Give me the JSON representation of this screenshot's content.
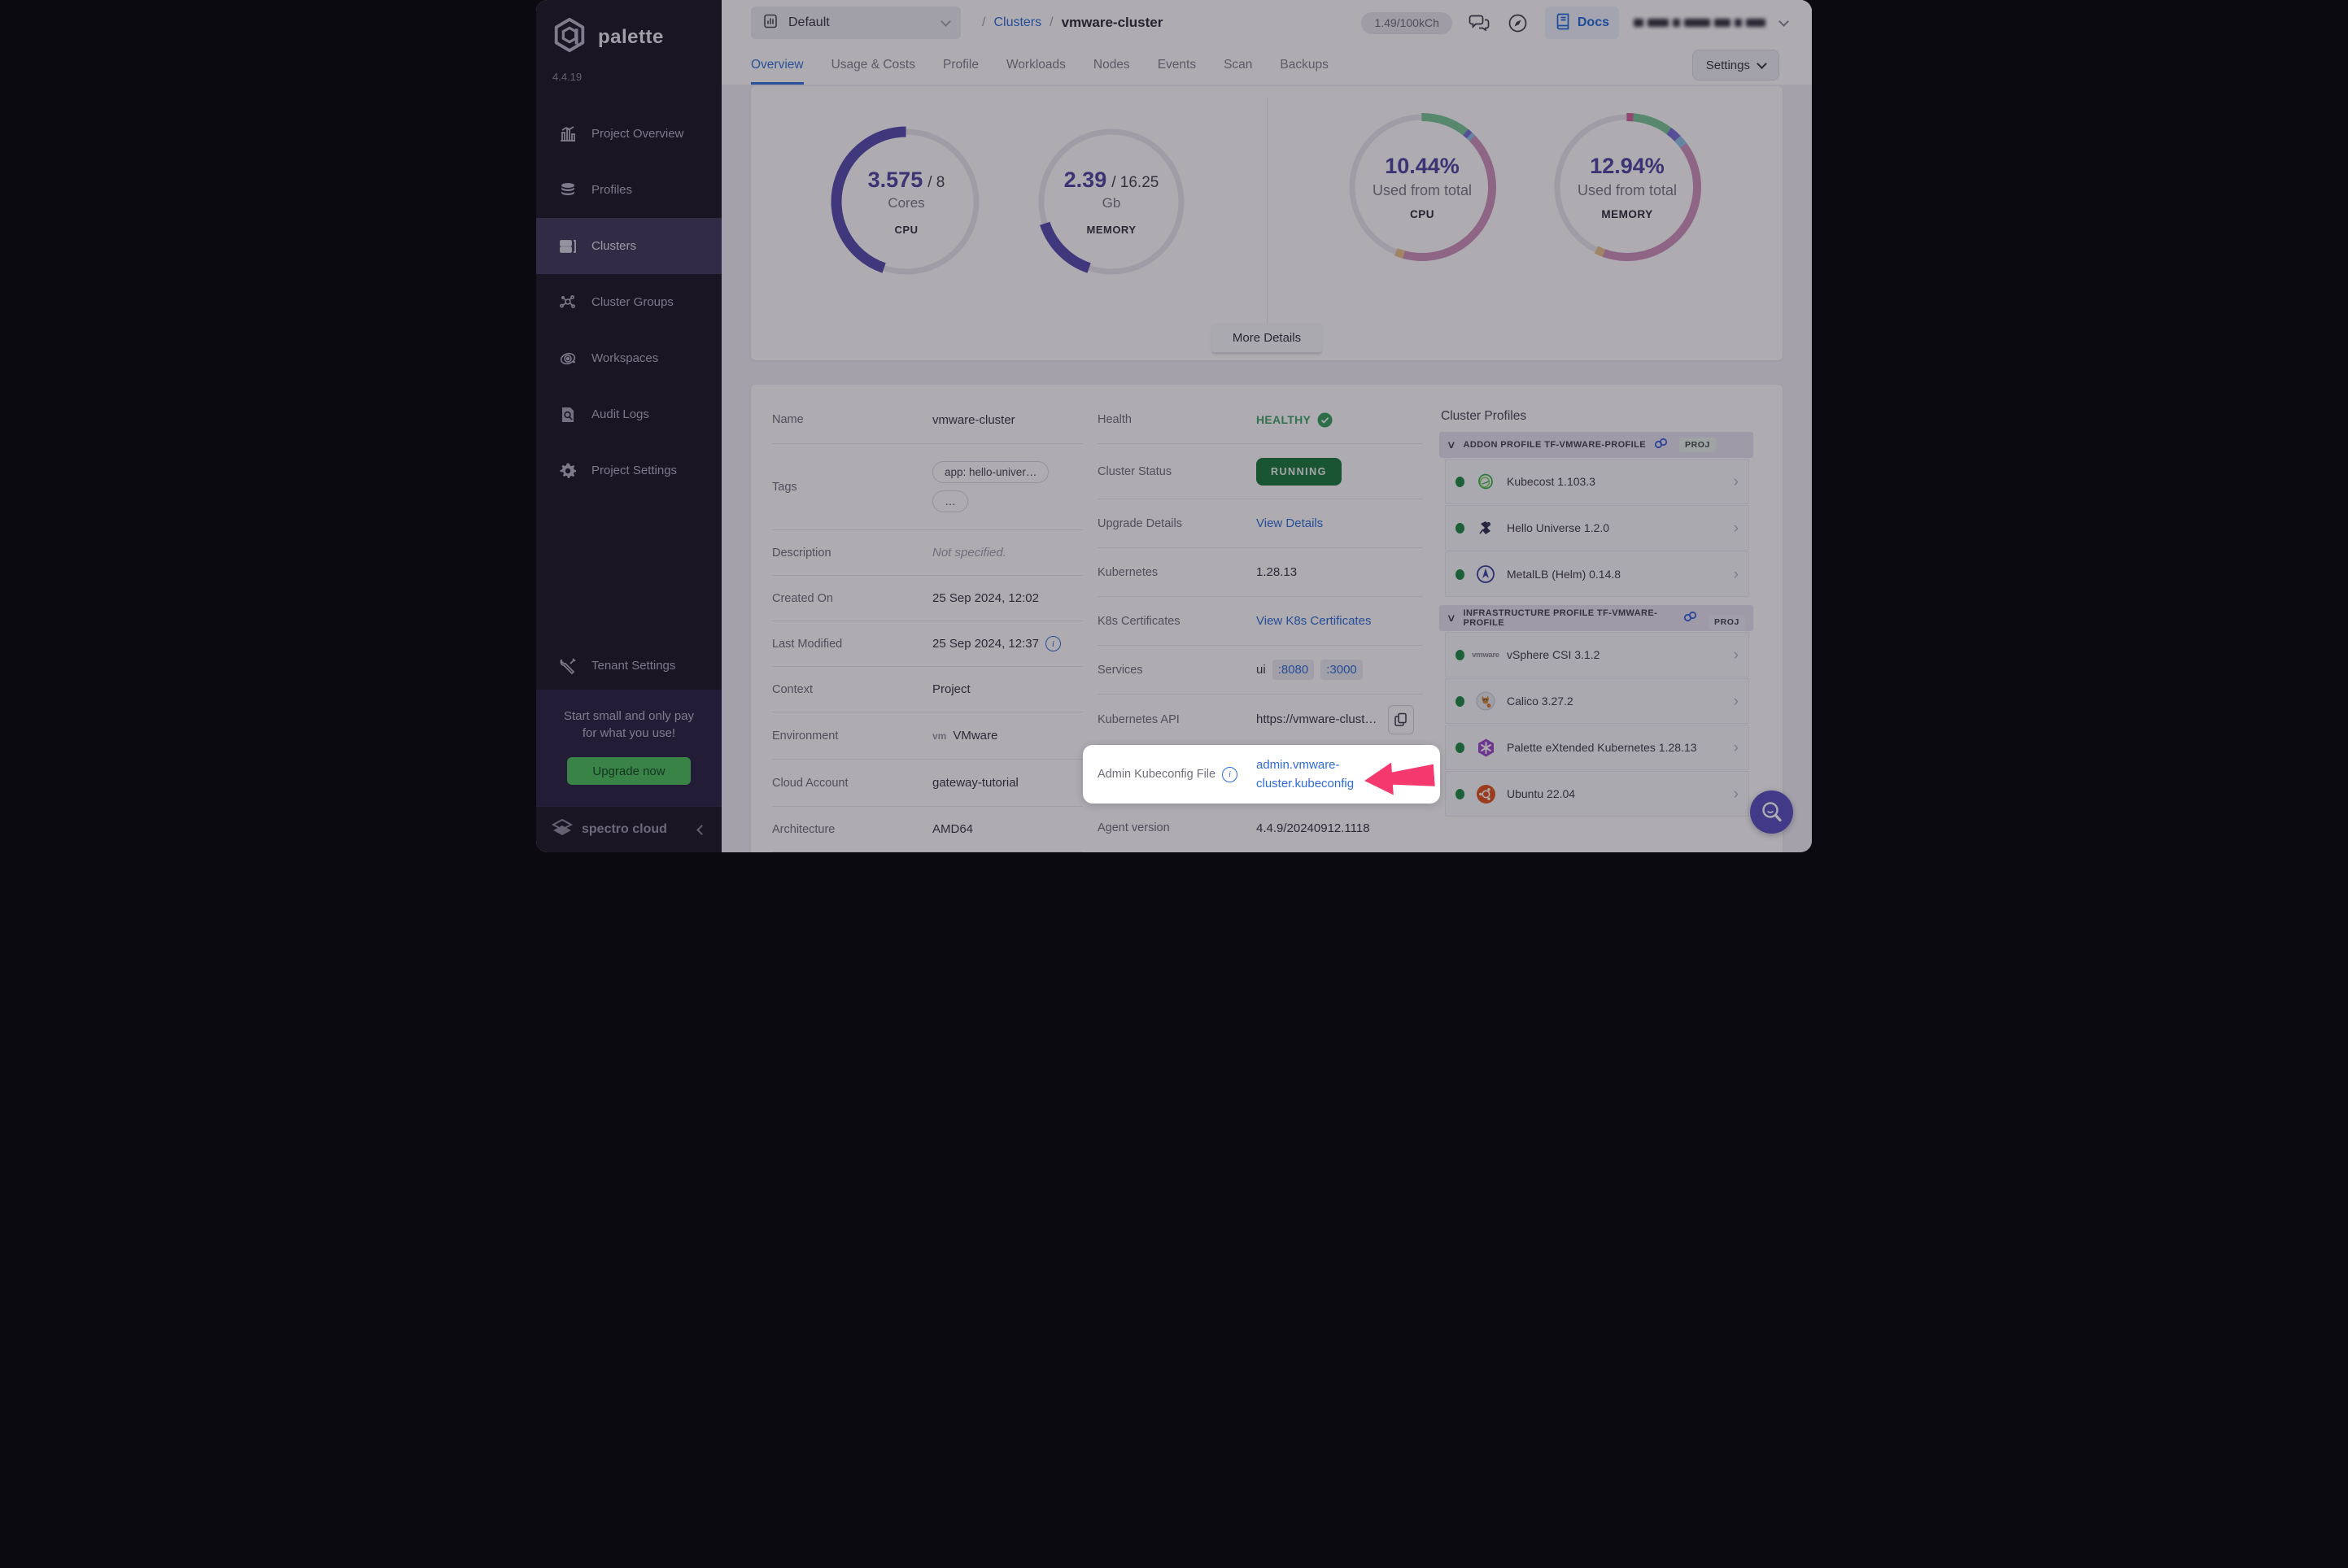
{
  "topbar": {
    "project_selector": {
      "label": "Default"
    },
    "breadcrumb": {
      "sep1": "/",
      "link": "Clusters",
      "sep2": "/",
      "current": "vmware-cluster"
    },
    "usage_pill": "1.49/100kCh",
    "docs_label": "Docs"
  },
  "tabs": {
    "labels": [
      "Overview",
      "Usage & Costs",
      "Profile",
      "Workloads",
      "Nodes",
      "Events",
      "Scan",
      "Backups"
    ],
    "active": "Overview",
    "settings_button": "Settings"
  },
  "sidebar": {
    "logo_text": "palette",
    "version": "4.4.19",
    "items": [
      {
        "label": "Project Overview"
      },
      {
        "label": "Profiles"
      },
      {
        "label": "Clusters",
        "selected": true
      },
      {
        "label": "Cluster Groups"
      },
      {
        "label": "Workspaces"
      },
      {
        "label": "Audit Logs"
      },
      {
        "label": "Project Settings"
      }
    ],
    "tenant_settings_label": "Tenant Settings",
    "promo": {
      "line1": "Start small and only pay",
      "line2": "for what you use!",
      "button": "Upgrade now"
    },
    "brand_footer": "spectro cloud"
  },
  "overview": {
    "more_details_button": "More Details"
  },
  "chart_data": [
    {
      "type": "donut",
      "title": "CPU usage",
      "value": "3.575",
      "value_total": "/ 8",
      "unit": "Cores",
      "footer": "CPU",
      "percent": 44.69,
      "rotate": 109,
      "color": "#564cae",
      "track": "#e8e7ef"
    },
    {
      "type": "donut",
      "title": "Memory usage",
      "value": "2.39",
      "value_total": "/ 16.25",
      "unit": "Gb",
      "footer": "MEMORY",
      "percent": 14.71,
      "rotate": 109,
      "color": "#564cae",
      "track": "#e8e7ef"
    },
    {
      "type": "donut-multi",
      "title": "CPU used from total",
      "headline": "10.44%",
      "sub": "Used from total",
      "footer": "CPU",
      "track": "#e8e7ef",
      "segments": [
        {
          "color": "#7ac695",
          "pct": 10.8
        },
        {
          "color": "#7a70d4",
          "pct": 1.1
        },
        {
          "color": "#8fc3ea",
          "pct": 0.9
        },
        {
          "color": "#cf92bd",
          "pct": 41.5
        },
        {
          "color": "#ecc28d",
          "pct": 1.8
        }
      ]
    },
    {
      "type": "donut-multi",
      "title": "Memory used from total",
      "headline": "12.94%",
      "sub": "Used from total",
      "footer": "MEMORY",
      "track": "#e8e7ef",
      "segments": [
        {
          "color": "#d4659f",
          "pct": 1.5
        },
        {
          "color": "#7ac695",
          "pct": 8.8
        },
        {
          "color": "#7a70d4",
          "pct": 2.6
        },
        {
          "color": "#8fc3ea",
          "pct": 2.1
        },
        {
          "color": "#cf92bd",
          "pct": 40.5
        },
        {
          "color": "#ecc28d",
          "pct": 1.8
        }
      ]
    }
  ],
  "details": {
    "name": {
      "label": "Name",
      "value": "vmware-cluster"
    },
    "tags": {
      "label": "Tags",
      "tag1": "app: hello-univer…",
      "tag2": "…"
    },
    "description": {
      "label": "Description",
      "value": "Not specified."
    },
    "created": {
      "label": "Created On",
      "value": "25 Sep 2024, 12:02"
    },
    "modified": {
      "label": "Last Modified",
      "value": "25 Sep 2024, 12:37"
    },
    "context": {
      "label": "Context",
      "value": "Project"
    },
    "environment": {
      "label": "Environment",
      "value": "VMware",
      "logo": "vm"
    },
    "cloud_account": {
      "label": "Cloud Account",
      "value": "gateway-tutorial"
    },
    "architecture": {
      "label": "Architecture",
      "value": "AMD64"
    },
    "health": {
      "label": "Health",
      "value": "HEALTHY"
    },
    "status": {
      "label": "Cluster Status",
      "value": "RUNNING"
    },
    "upgrade": {
      "label": "Upgrade Details",
      "link": "View Details"
    },
    "kubernetes": {
      "label": "Kubernetes",
      "value": "1.28.13"
    },
    "certs": {
      "label": "K8s Certificates",
      "link": "View K8s Certificates"
    },
    "services": {
      "label": "Services",
      "prefix": "ui",
      "port1": ":8080",
      "port2": ":3000"
    },
    "api": {
      "label": "Kubernetes API",
      "value": "https://vmware-clust…"
    },
    "kubeconfig": {
      "label": "Admin Kubeconfig File",
      "link_line1": "admin.vmware-",
      "link_line2": "cluster.kubeconfig"
    },
    "agent": {
      "label": "Agent version",
      "value": "4.4.9/20240912.1118"
    }
  },
  "cluster_profiles": {
    "title": "Cluster Profiles",
    "groups": [
      {
        "name": "ADDON PROFILE TF-VMWARE-PROFILE",
        "badge": "PROJ",
        "items": [
          {
            "name": "Kubecost 1.103.3",
            "icon": "kubecost"
          },
          {
            "name": "Hello Universe 1.2.0",
            "icon": "hello-universe"
          },
          {
            "name": "MetalLB (Helm) 0.14.8",
            "icon": "metallb"
          }
        ]
      },
      {
        "name": "INFRASTRUCTURE PROFILE TF-VMWARE-PROFILE",
        "badge": "PROJ",
        "items": [
          {
            "name": "vSphere CSI 3.1.2",
            "icon": "vmware"
          },
          {
            "name": "Calico 3.27.2",
            "icon": "calico"
          },
          {
            "name": "Palette eXtended Kubernetes 1.28.13",
            "icon": "palette-extended-kubernetes"
          },
          {
            "name": "Ubuntu 22.04",
            "icon": "ubuntu"
          }
        ]
      }
    ]
  },
  "colors": {
    "accent_blue": "#2e6cd9",
    "status_green": "#1d7a3e",
    "arrow_pink": "#f5386e",
    "fab_purple": "#5a50c0",
    "donut_indigo": "#564cae"
  }
}
